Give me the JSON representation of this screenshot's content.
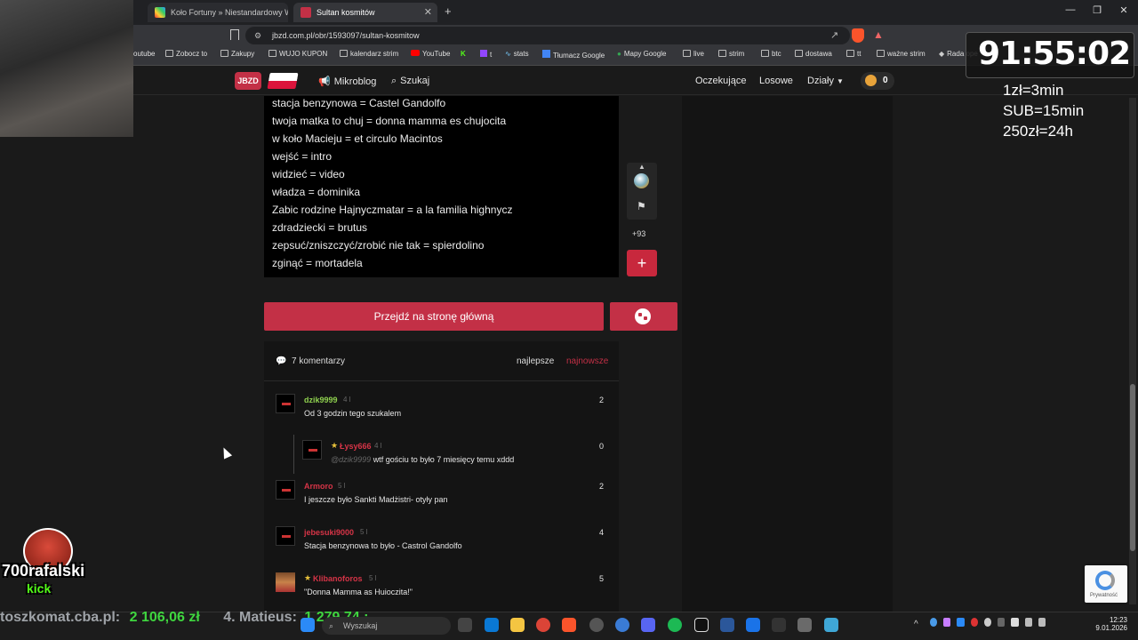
{
  "browser": {
    "tabs": [
      {
        "label": "Koło Fortuny » Niestandardowy Wyb"
      },
      {
        "label": "Sultan kosmitów"
      }
    ],
    "url": "jbzd.com.pl/obr/1593097/sultan-kosmitow",
    "bookmarks": [
      "outube",
      "Zobocz to",
      "Zakupy",
      "WUJO KUPON",
      "kalendarz strim",
      "YouTube",
      "t",
      "stats",
      "Tłumacz Google",
      "Mapy Google",
      "live",
      "strim",
      "btc",
      "dostawa",
      "tt",
      "ważne strim",
      "Rada ope"
    ]
  },
  "site": {
    "logo": "JBZD",
    "nav": {
      "mikroblog": "Mikroblog",
      "search": "Szukaj",
      "waiting": "Oczekujące",
      "random": "Losowe",
      "sections": "Działy",
      "coins": "0"
    }
  },
  "post": {
    "lines": [
      "stacja benzynowa = Castel Gandolfo",
      "twoja matka to chuj = donna mamma es chujocita",
      "w koło Macieju = et circulo Macintos",
      "wejść = intro",
      "widzieć = video",
      "władza = dominika",
      "Zabic rodzine Hajnyczmatar = a la familia highnycz",
      "zdradziecki = brutus",
      "zepsuć/zniszczyć/zrobić nie tak = spierdolino",
      "zginąć = mortadela"
    ],
    "votes": "+93",
    "plus": "+",
    "home_button": "Przejdź na stronę główną"
  },
  "comments": {
    "count_label": "7 komentarzy",
    "sort_best": "najlepsze",
    "sort_newest": "najnowsze",
    "items": [
      {
        "author": "dzik9999",
        "meta": "4 l",
        "text": "Od 3 godzin tego szukalem",
        "score": "2"
      },
      {
        "author": "Łysy666",
        "meta": "4 l",
        "mention": "@dzik9999",
        "text": "wtf gościu to było 7 miesięcy temu xddd",
        "score": "0"
      },
      {
        "author": "Armoro",
        "meta": "5 l",
        "text": "I jeszcze było Sankti Madżistri- otyły pan",
        "score": "2"
      },
      {
        "author": "jebesuki9000",
        "meta": "5 l",
        "text": "Stacja benzynowa to było - Castrol Gandolfo",
        "score": "4"
      },
      {
        "author": "Klibanoforos",
        "meta": "5 l",
        "text": "\"Donna Mamma as Huioczita!\"",
        "score": "5"
      }
    ]
  },
  "overlay": {
    "timer": "91:55:02",
    "rates": [
      "1zł=3min",
      "SUB=15min",
      "250zł=24h"
    ],
    "ticker_a": "toszkomat.cba.pl:",
    "ticker_a_val": "2 106,06 zł",
    "ticker_b": "4. Matieus:",
    "ticker_b_val": "1 279,74 ;",
    "logo_text": "700rafalski",
    "logo_sub": "kick"
  },
  "taskbar": {
    "search_placeholder": "Wyszukaj",
    "time": "12:23",
    "date": "9.01.2026"
  },
  "recaptcha": {
    "label": "Prywatność"
  },
  "colors": {
    "accent": "#c33046",
    "green_user": "#8fd14f",
    "red_user": "#d63447",
    "ticker_green": "#3fd63f"
  }
}
